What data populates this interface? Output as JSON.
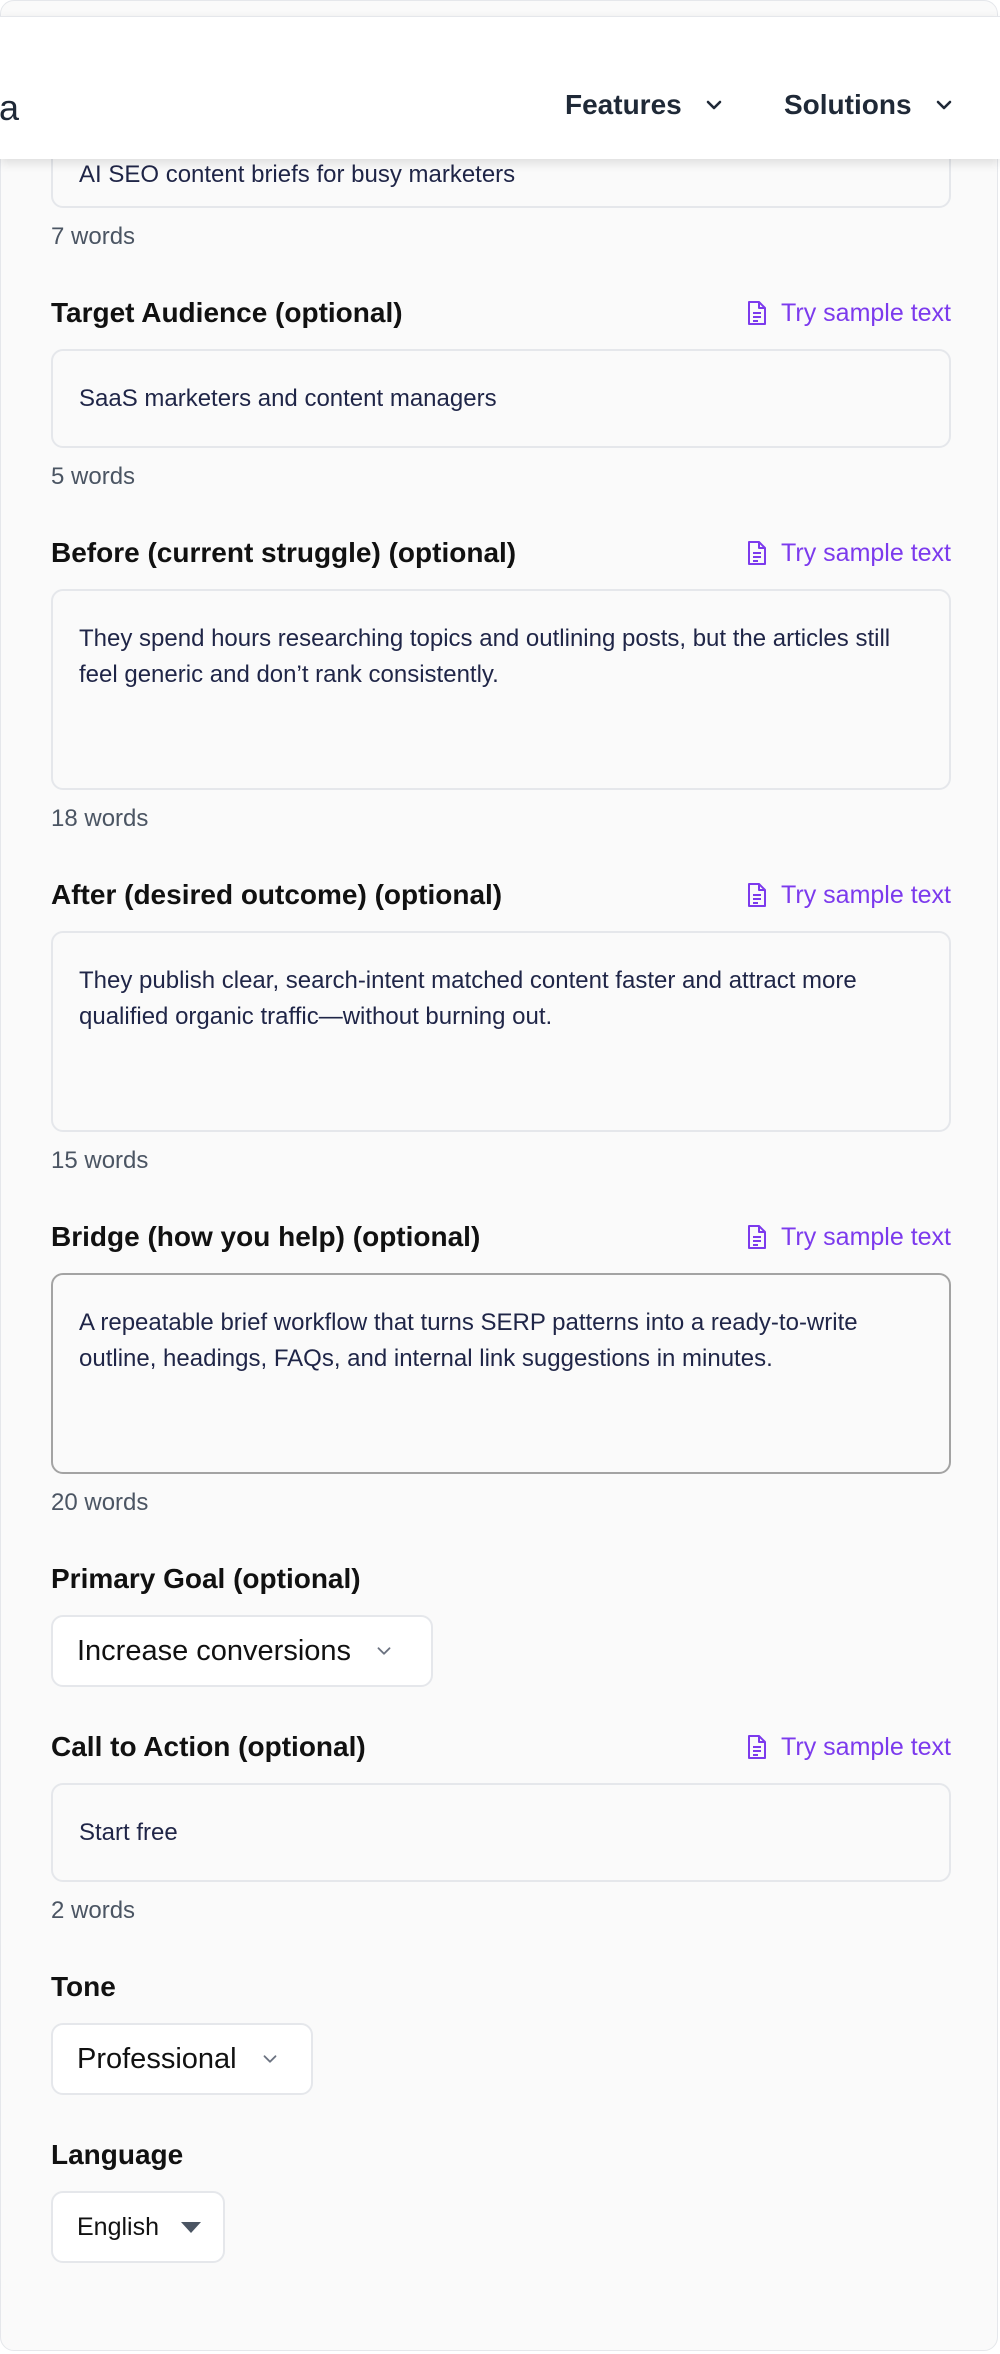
{
  "nav": {
    "brand_partial": "ia",
    "features_label": "Features",
    "solutions_label": "Solutions"
  },
  "sample_link_label": "Try sample text",
  "fields": {
    "product": {
      "value": "AI SEO content briefs for busy marketers",
      "word_count": "7 words"
    },
    "audience": {
      "label": "Target Audience (optional)",
      "value": "SaaS marketers and content managers",
      "word_count": "5 words"
    },
    "before": {
      "label": "Before (current struggle) (optional)",
      "value": "They spend hours researching topics and outlining posts, but the articles still feel generic and don’t rank consistently.",
      "word_count": "18 words"
    },
    "after": {
      "label": "After (desired outcome) (optional)",
      "value": "They publish clear, search-intent matched content faster and attract more qualified organic traffic—without burning out.",
      "word_count": "15 words"
    },
    "bridge": {
      "label": "Bridge (how you help) (optional)",
      "value": "A repeatable brief workflow that turns SERP patterns into a ready-to-write outline, headings, FAQs, and internal link suggestions in minutes.",
      "word_count": "20 words"
    },
    "goal": {
      "label": "Primary Goal (optional)",
      "selected": "Increase conversions"
    },
    "cta": {
      "label": "Call to Action (optional)",
      "value": "Start free",
      "word_count": "2 words"
    },
    "tone": {
      "label": "Tone",
      "selected": "Professional"
    },
    "language": {
      "label": "Language",
      "selected": "English"
    }
  },
  "colors": {
    "accent": "#7c3aed",
    "background": "#fafafa",
    "border": "#e5e7eb",
    "input_text": "#1f2547"
  },
  "icons": {
    "nav_chevron": "chevron-down-icon",
    "sample_link": "document-icon",
    "select_chevron": "chevron-down-icon",
    "language_caret": "caret-down-icon"
  }
}
